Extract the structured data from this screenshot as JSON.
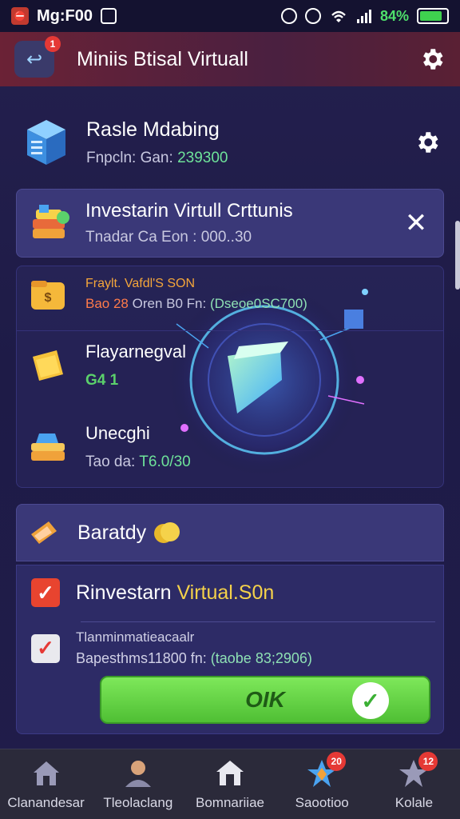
{
  "status_bar": {
    "time": "Mg:F00",
    "battery_pct": "84%",
    "battery_level": 0.84
  },
  "header": {
    "title": "Miniis Btisal Virtuall",
    "back_badge": "1"
  },
  "top_row": {
    "title": "Rasle Mdabing",
    "sub_label": "Fnpcln: Gan: ",
    "sub_value": "239300"
  },
  "invest_card": {
    "title": "Investarin Virtull Crttunis",
    "sub": "Tnadar Ca Eon : 000..30",
    "close": "✕"
  },
  "list": {
    "item1": {
      "title": "Fraylt. Vafdl'S SON",
      "sub_label": "Bao 28",
      "sub_mid": " Oren B0 Fn: ",
      "sub_value": "(Dseoe0SC700)"
    },
    "item2": {
      "title": "Flayarnegval",
      "sub": "G4 1"
    },
    "item3": {
      "title": "Unecghi",
      "sub_label": "Tao da: ",
      "sub_value": "T6.0/30"
    }
  },
  "bar_card": {
    "title": "Baratdy"
  },
  "confirm": {
    "row1_prefix": "Rinvestarn ",
    "row1_highlight": "Virtual.S0n",
    "row2_title": "Tlanminmatieacaalr",
    "row2_sub_label": "Bapesthms11800 fn: ",
    "row2_sub_value": "(taobe 83;2906)",
    "ok_label": "OIK"
  },
  "bottom_nav": [
    {
      "label": "Clanandesar",
      "icon": "home-icon",
      "badge": ""
    },
    {
      "label": "Tleolaclang",
      "icon": "profile-icon",
      "badge": ""
    },
    {
      "label": "Bomnariiae",
      "icon": "house-icon",
      "badge": ""
    },
    {
      "label": "Saootioo",
      "icon": "star-icon",
      "badge": "20"
    },
    {
      "label": "Kolale",
      "icon": "star-icon",
      "badge": "12"
    }
  ],
  "colors": {
    "accent_green": "#4fbf34",
    "header_bg": "#6b2236",
    "card_bg": "#3a3878",
    "value_green": "#6ee39a",
    "highlight_yellow": "#f5d24a"
  }
}
